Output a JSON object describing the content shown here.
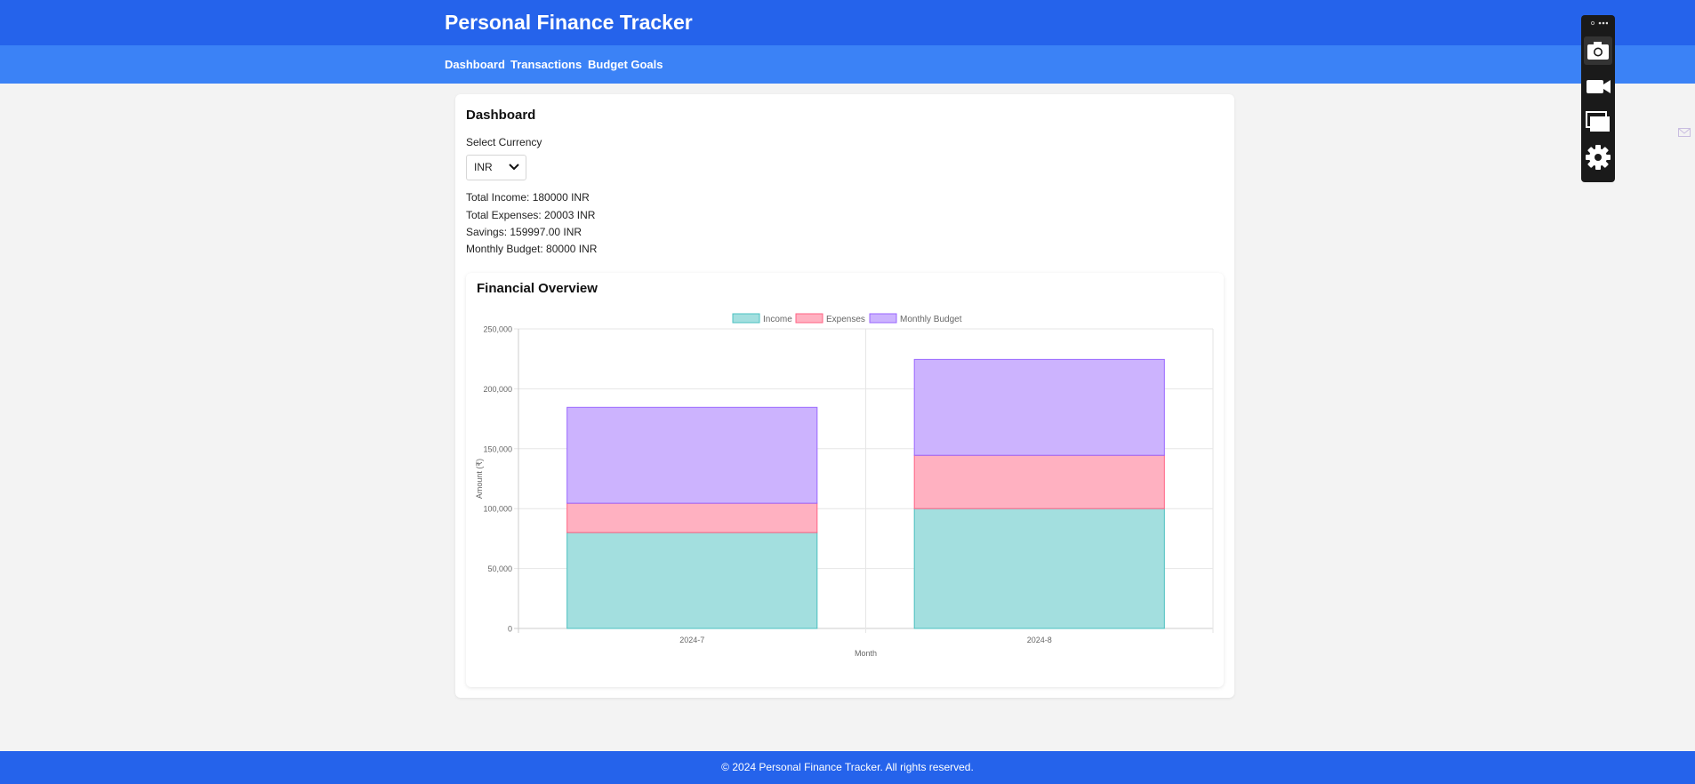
{
  "header": {
    "title": "Personal Finance Tracker"
  },
  "nav": {
    "items": [
      "Dashboard",
      "Transactions",
      "Budget Goals"
    ]
  },
  "dashboard": {
    "title": "Dashboard",
    "currency_label": "Select Currency",
    "currency_value": "INR",
    "stats": {
      "total_income": "Total Income: 180000 INR",
      "total_expenses": "Total Expenses: 20003 INR",
      "savings": "Savings: 159997.00 INR",
      "monthly_budget": "Monthly Budget: 80000 INR"
    }
  },
  "chart_card": {
    "title": "Financial Overview"
  },
  "chart_data": {
    "type": "bar",
    "stacked": true,
    "categories": [
      "2024-7",
      "2024-8"
    ],
    "series": [
      {
        "name": "Income",
        "values": [
          80000,
          100000
        ],
        "fill": "#a3dfdf",
        "stroke": "#4bc0c0"
      },
      {
        "name": "Expenses",
        "values": [
          24500,
          44500
        ],
        "fill": "#ffb1c1",
        "stroke": "#ff6384"
      },
      {
        "name": "Monthly Budget",
        "values": [
          80000,
          80000
        ],
        "fill": "#ccb3fe",
        "stroke": "#9966ff"
      }
    ],
    "title": "",
    "xlabel": "Month",
    "ylabel": "Amount (₹)",
    "ylim": [
      0,
      250000
    ],
    "yticks": [
      0,
      50000,
      100000,
      150000,
      200000,
      250000
    ],
    "ytick_labels": [
      "0",
      "50,000",
      "100,000",
      "150,000",
      "200,000",
      "250,000"
    ],
    "grid": true,
    "legend_position": "top"
  },
  "footer": {
    "text": "© 2024 Personal Finance Tracker. All rights reserved."
  },
  "toolbar": {
    "icons": [
      "camera-icon",
      "video-camera-icon",
      "windows-icon",
      "gear-icon"
    ]
  }
}
